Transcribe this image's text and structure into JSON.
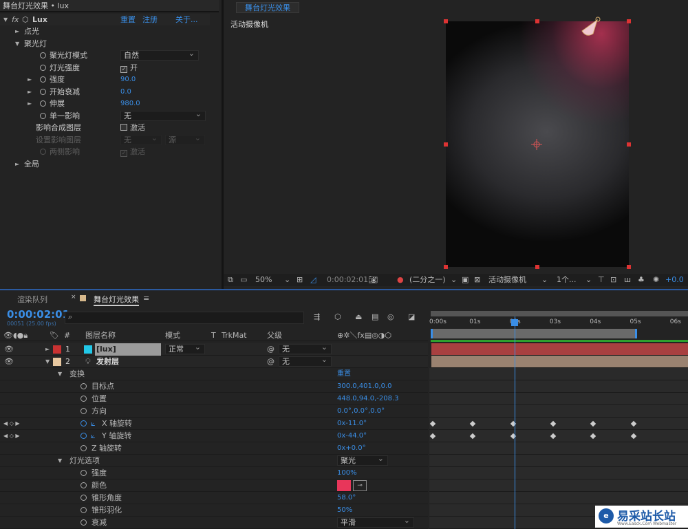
{
  "effects_panel": {
    "title": "舞台灯光效果 • lux",
    "effect_name": "Lux",
    "reset": "重置",
    "register": "注册",
    "about": "关于...",
    "rows": [
      {
        "label": "点光",
        "indent": 1,
        "twirl": "closed"
      },
      {
        "label": "聚光灯",
        "indent": 1,
        "twirl": "open"
      },
      {
        "label": "聚光灯模式",
        "indent": 3,
        "stopwatch": true,
        "dropdown": "自然"
      },
      {
        "label": "灯光强度",
        "indent": 3,
        "stopwatch": true,
        "checkbox": true,
        "checked": true,
        "value": "开"
      },
      {
        "label": "强度",
        "indent": 3,
        "twirl": "closed",
        "stopwatch": true,
        "number": "90.0"
      },
      {
        "label": "开始衰减",
        "indent": 3,
        "twirl": "closed",
        "stopwatch": true,
        "number": "0.0"
      },
      {
        "label": "伸展",
        "indent": 3,
        "twirl": "closed",
        "stopwatch": true,
        "number": "980.0"
      },
      {
        "label": "单一影响",
        "indent": 3,
        "stopwatch": true,
        "dropdown": "无"
      },
      {
        "label": "影响合成图层",
        "indent": 2,
        "checkbox": true,
        "checked": false,
        "value": "激活"
      },
      {
        "label": "设置影响图层",
        "indent": 2,
        "disabled": true,
        "dropdown": "无",
        "dropdown2": "源"
      },
      {
        "label": "两侧影响",
        "indent": 3,
        "disabled": true,
        "stopwatch": true,
        "checkbox": true,
        "checked": true,
        "value": "激活"
      },
      {
        "label": "全局",
        "indent": 1,
        "twirl": "closed"
      }
    ]
  },
  "viewer": {
    "tab": "舞台灯光效果",
    "camera_label": "活动摄像机",
    "toolbar": {
      "zoom": "50%",
      "timecode": "0:00:02:01",
      "resolution": "(二分之一)",
      "camera": "活动摄像机",
      "views": "1个...",
      "exposure": "+0.0"
    }
  },
  "timeline": {
    "tabs": [
      {
        "label": "渲染队列"
      },
      {
        "label": "舞台灯光效果",
        "active": true
      }
    ],
    "timecode": "0:00:02:01",
    "frame_info": "00051 (25.00 fps)",
    "columns": {
      "name": "图层名称",
      "mode": "模式",
      "t": "T",
      "trkmat": "TrkMat",
      "parent": "父级",
      "num": "#"
    },
    "ruler": [
      "0:00s",
      "01s",
      "02s",
      "03s",
      "04s",
      "05s",
      "06s"
    ],
    "layers": [
      {
        "num": "1",
        "name": "[lux]",
        "label_color": "#c83232",
        "icon_color": "#22c8e8",
        "mode": "正常",
        "parent": "无",
        "bar_color": "#a84040"
      },
      {
        "num": "2",
        "name": "发射层",
        "label_color": "#e8c8a0",
        "parent": "无",
        "bar_color": "#9a8270"
      }
    ],
    "properties": [
      {
        "label": "变换",
        "group": true,
        "value": "重置"
      },
      {
        "label": "目标点",
        "value": "300.0,401.0,0.0"
      },
      {
        "label": "位置",
        "value": "448.0,94.0,-208.3"
      },
      {
        "label": "方向",
        "value": "0.0°,0.0°,0.0°"
      },
      {
        "label": "X 轴旋转",
        "value": "0x-11.0°",
        "animated": true,
        "keyframes": [
          0,
          1,
          2,
          3,
          4,
          5
        ]
      },
      {
        "label": "Y 轴旋转",
        "value": "0x-44.0°",
        "animated": true,
        "keyframes": [
          0,
          1,
          2,
          3,
          4,
          5
        ]
      },
      {
        "label": "Z 轴旋转",
        "value": "0x+0.0°"
      },
      {
        "label": "灯光选项",
        "group": true,
        "dropdown": "聚光"
      },
      {
        "label": "强度",
        "value": "100%"
      },
      {
        "label": "颜色",
        "color": "#e8365a"
      },
      {
        "label": "锥形角度",
        "value": "58.0°"
      },
      {
        "label": "锥形羽化",
        "value": "50%"
      },
      {
        "label": "衰减",
        "dropdown": "平滑"
      }
    ]
  },
  "watermark": {
    "text": "易采站长站",
    "sub": "Www.Easck.Com Webmaster"
  }
}
